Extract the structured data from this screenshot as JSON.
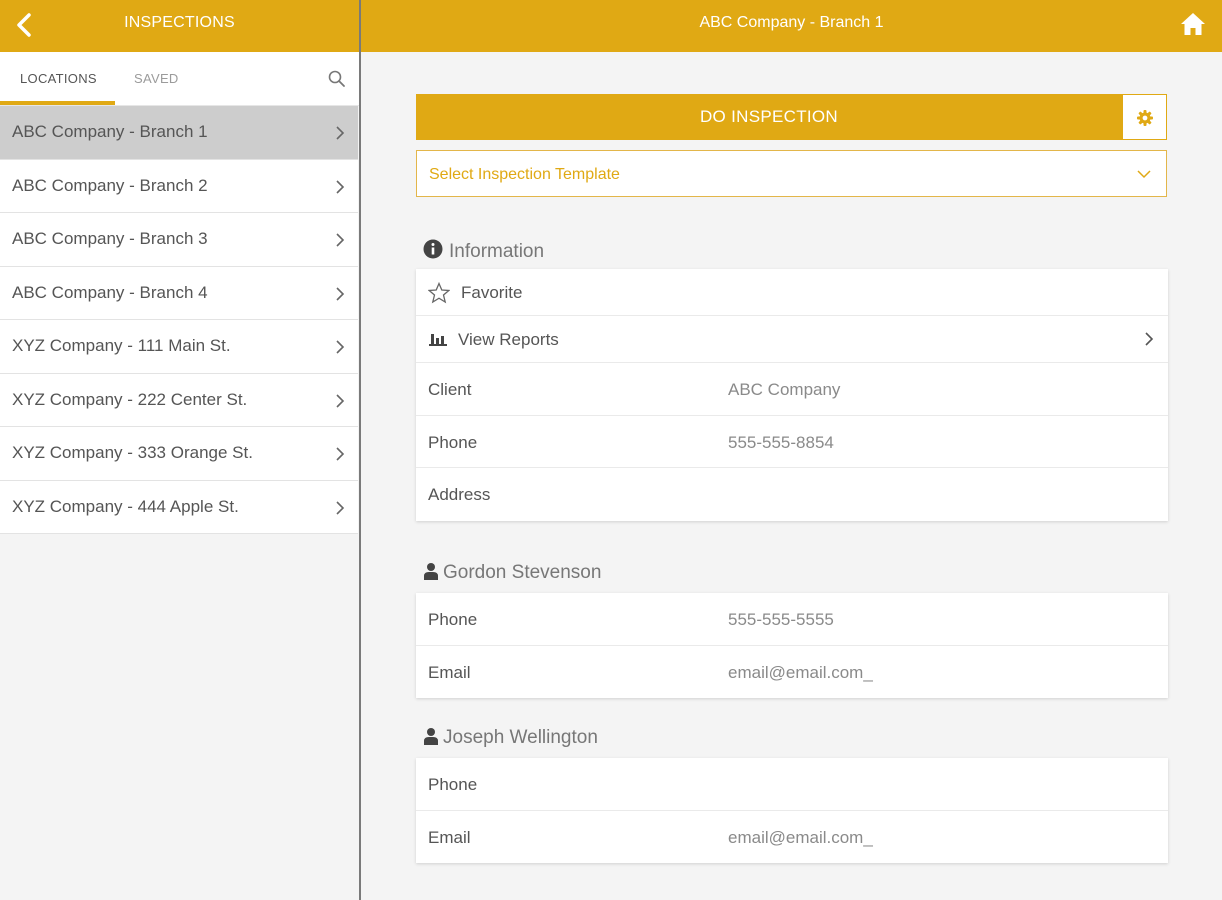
{
  "left_header": {
    "title": "INSPECTIONS",
    "back_icon": "chevron-left-icon"
  },
  "tabs": [
    {
      "label": "LOCATIONS",
      "active": true
    },
    {
      "label": "SAVED",
      "active": false
    }
  ],
  "search_icon": "search-icon",
  "locations": [
    {
      "label": "ABC Company - Branch 1",
      "selected": true
    },
    {
      "label": "ABC Company - Branch 2",
      "selected": false
    },
    {
      "label": "ABC Company - Branch 3",
      "selected": false
    },
    {
      "label": "ABC Company - Branch 4",
      "selected": false
    },
    {
      "label": "XYZ Company - 111 Main St.",
      "selected": false
    },
    {
      "label": "XYZ Company - 222 Center St.",
      "selected": false
    },
    {
      "label": "XYZ Company - 333 Orange St.",
      "selected": false
    },
    {
      "label": "XYZ Company - 444 Apple St.",
      "selected": false
    }
  ],
  "right_header": {
    "title": "ABC Company - Branch 1",
    "home_icon": "home-icon"
  },
  "actions": {
    "do_inspection": "DO INSPECTION",
    "settings_icon": "gear-icon",
    "template_placeholder": "Select Inspection Template"
  },
  "info": {
    "heading": "Information",
    "favorite": "Favorite",
    "view_reports": "View Reports",
    "client_label": "Client",
    "client_value": "ABC Company",
    "phone_label": "Phone",
    "phone_value": "555-555-8854",
    "address_label": "Address",
    "address_value": ""
  },
  "contacts": [
    {
      "name": "Gordon Stevenson",
      "phone_label": "Phone",
      "phone_value": "555-555-5555",
      "email_label": "Email",
      "email_value": "email@email.com_"
    },
    {
      "name": "Joseph Wellington",
      "phone_label": "Phone",
      "phone_value": "",
      "email_label": "Email",
      "email_value": "email@email.com_"
    }
  ],
  "colors": {
    "accent": "#e0a914",
    "selected_row": "#cdcdcd",
    "background": "#f4f4f4"
  }
}
